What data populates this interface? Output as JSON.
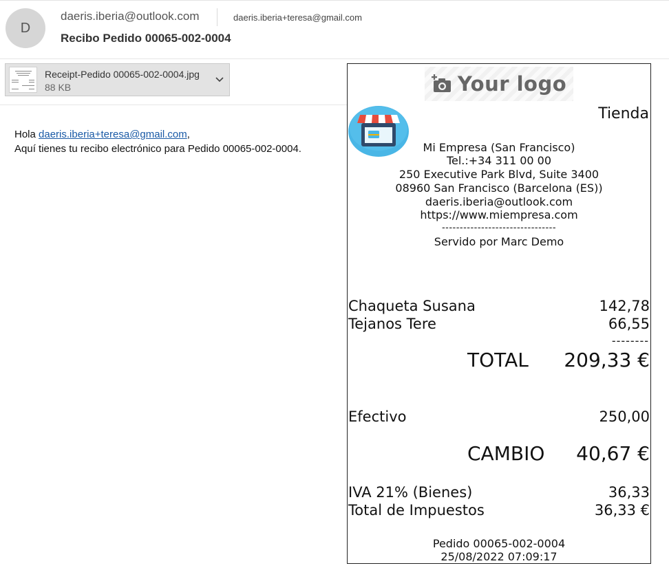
{
  "email": {
    "avatar_letter": "D",
    "sender": "daeris.iberia@outlook.com",
    "recipient": "daeris.iberia+teresa@gmail.com",
    "subject": "Recibo Pedido 00065-002-0004",
    "attachment": {
      "name": "Receipt-Pedido 00065-002-0004.jpg",
      "size": "88 KB"
    },
    "body": {
      "greeting": "Hola",
      "link": "daeris.iberia+teresa@gmail.com",
      "comma": ",",
      "line2": "Aquí tienes tu recibo electrónico para Pedido 00065-002-0004."
    }
  },
  "receipt": {
    "logo_text": "Your logo",
    "store_label": "Tienda",
    "company": "Mi Empresa (San Francisco)",
    "phone": "Tel.:+34 311 00 00",
    "address1": "250 Executive Park Blvd, Suite 3400",
    "address2": "08960 San Francisco (Barcelona (ES))",
    "email": "daeris.iberia@outlook.com",
    "website": "https://www.miempresa.com",
    "separator": "--------------------------------",
    "served_by": "Servido por Marc Demo",
    "lines": [
      {
        "name": "Chaqueta Susana",
        "amount": "142,78"
      },
      {
        "name": "Tejanos Tere",
        "amount": "66,55"
      }
    ],
    "dash_line": "--------",
    "total_label": "TOTAL",
    "total_value": "209,33 €",
    "payment_label": "Efectivo",
    "payment_value": "250,00",
    "change_label": "CAMBIO",
    "change_value": "40,67 €",
    "tax_label": "IVA 21% (Bienes)",
    "tax_value": "36,33",
    "tax_total_label": "Total de Impuestos",
    "tax_total_value": "36,33 €",
    "order": "Pedido 00065-002-0004",
    "datetime": "25/08/2022 07:09:17"
  },
  "icons": {
    "attachment_menu": "chevron-down-icon",
    "logo": "camera-add-icon",
    "store": "store-icon"
  },
  "colors": {
    "link": "#1a5aa6",
    "avatar_bg": "#d6d6d6",
    "store_icon_bg": "#49b6e6"
  }
}
